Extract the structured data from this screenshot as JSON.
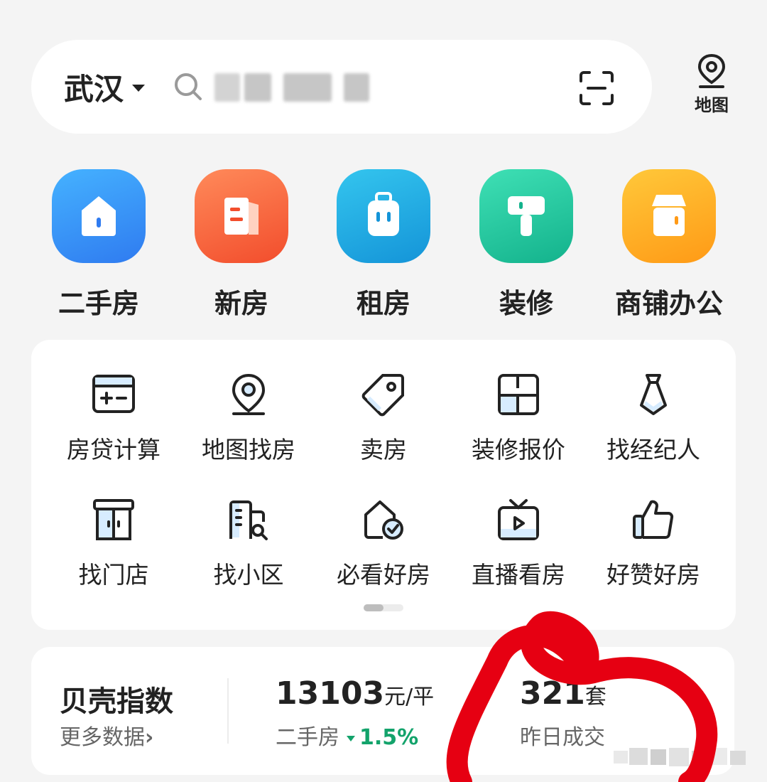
{
  "search": {
    "city": "武汉",
    "placeholder_masked": "",
    "map_label": "地图"
  },
  "services": [
    {
      "label": "二手房",
      "icon": "house-icon",
      "color_from": "#45b2ff",
      "color_to": "#2f7bf0"
    },
    {
      "label": "新房",
      "icon": "new-building-icon",
      "color_from": "#ff8a5a",
      "color_to": "#f24d2c"
    },
    {
      "label": "租房",
      "icon": "luggage-icon",
      "color_from": "#34c5ee",
      "color_to": "#1494d8"
    },
    {
      "label": "装修",
      "icon": "paint-roller-icon",
      "color_from": "#3fe0b5",
      "color_to": "#13b28c"
    },
    {
      "label": "商铺办公",
      "icon": "shop-icon",
      "color_from": "#ffc83a",
      "color_to": "#ff9a16"
    }
  ],
  "tools": [
    {
      "label": "房贷计算",
      "icon": "calculator-icon"
    },
    {
      "label": "地图找房",
      "icon": "map-pin-icon"
    },
    {
      "label": "卖房",
      "icon": "price-tag-icon"
    },
    {
      "label": "装修报价",
      "icon": "floorplan-icon"
    },
    {
      "label": "找经纪人",
      "icon": "agent-tie-icon"
    },
    {
      "label": "找门店",
      "icon": "storefront-icon"
    },
    {
      "label": "找小区",
      "icon": "community-search-icon"
    },
    {
      "label": "必看好房",
      "icon": "verified-house-icon"
    },
    {
      "label": "直播看房",
      "icon": "live-tv-icon"
    },
    {
      "label": "好赞好房",
      "icon": "thumbs-up-icon"
    }
  ],
  "index": {
    "title": "贝壳指数",
    "more": "更多数据",
    "price_value": "13103",
    "price_unit": "元/平",
    "price_label": "二手房",
    "price_trend": "1.5%",
    "deal_value": "321",
    "deal_unit": "套",
    "deal_label": "昨日成交"
  },
  "colors": {
    "background": "#f4f4f4",
    "card": "#ffffff",
    "trend_green": "#13a36b",
    "annotation_red": "#e60012"
  }
}
